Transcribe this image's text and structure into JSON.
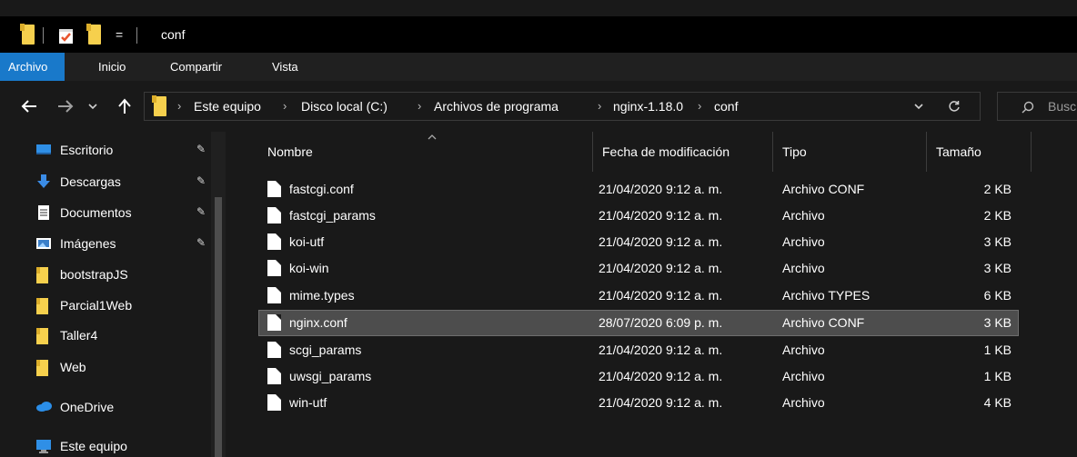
{
  "window": {
    "title": "conf"
  },
  "quick_access_toolbar": {
    "icons": [
      "folder-icon",
      "properties-icon",
      "new-folder-icon",
      "customize-dropdown-icon"
    ],
    "dropdown_glyph": "="
  },
  "ribbon": {
    "tabs": [
      {
        "label": "Archivo",
        "active": true
      },
      {
        "label": "Inicio",
        "active": false
      },
      {
        "label": "Compartir",
        "active": false
      },
      {
        "label": "Vista",
        "active": false
      }
    ],
    "active_color": "#1979ca"
  },
  "navigation": {
    "back_icon": "arrow-left-icon",
    "forward_icon": "arrow-right-icon",
    "recent_icon": "chevron-down-icon",
    "up_icon": "arrow-up-icon",
    "breadcrumbs": [
      "Este equipo",
      "Disco local (C:)",
      "Archivos de programa",
      "nginx-1.18.0",
      "conf"
    ],
    "search_placeholder": "Busc"
  },
  "sidebar": {
    "items": [
      {
        "label": "Escritorio",
        "icon": "desktop-icon",
        "pinned": true
      },
      {
        "label": "Descargas",
        "icon": "download-icon",
        "pinned": true
      },
      {
        "label": "Documentos",
        "icon": "document-icon",
        "pinned": true
      },
      {
        "label": "Imágenes",
        "icon": "picture-icon",
        "pinned": true
      },
      {
        "label": "bootstrapJS",
        "icon": "folder-icon",
        "pinned": false
      },
      {
        "label": "Parcial1Web",
        "icon": "folder-icon",
        "pinned": false
      },
      {
        "label": "Taller4",
        "icon": "folder-icon",
        "pinned": false
      },
      {
        "label": "Web",
        "icon": "folder-icon",
        "pinned": false
      },
      {
        "label": "OneDrive",
        "icon": "cloud-icon",
        "pinned": false
      },
      {
        "label": "Este equipo",
        "icon": "computer-icon",
        "pinned": false
      }
    ]
  },
  "file_list": {
    "columns": {
      "name": "Nombre",
      "modified": "Fecha de modificación",
      "type": "Tipo",
      "size": "Tamaño"
    },
    "rows": [
      {
        "name": "fastcgi.conf",
        "modified": "21/04/2020 9:12 a. m.",
        "type": "Archivo CONF",
        "size": "2 KB",
        "selected": false
      },
      {
        "name": "fastcgi_params",
        "modified": "21/04/2020 9:12 a. m.",
        "type": "Archivo",
        "size": "2 KB",
        "selected": false
      },
      {
        "name": "koi-utf",
        "modified": "21/04/2020 9:12 a. m.",
        "type": "Archivo",
        "size": "3 KB",
        "selected": false
      },
      {
        "name": "koi-win",
        "modified": "21/04/2020 9:12 a. m.",
        "type": "Archivo",
        "size": "3 KB",
        "selected": false
      },
      {
        "name": "mime.types",
        "modified": "21/04/2020 9:12 a. m.",
        "type": "Archivo TYPES",
        "size": "6 KB",
        "selected": false
      },
      {
        "name": "nginx.conf",
        "modified": "28/07/2020 6:09 p. m.",
        "type": "Archivo CONF",
        "size": "3 KB",
        "selected": true
      },
      {
        "name": "scgi_params",
        "modified": "21/04/2020 9:12 a. m.",
        "type": "Archivo",
        "size": "1 KB",
        "selected": false
      },
      {
        "name": "uwsgi_params",
        "modified": "21/04/2020 9:12 a. m.",
        "type": "Archivo",
        "size": "1 KB",
        "selected": false
      },
      {
        "name": "win-utf",
        "modified": "21/04/2020 9:12 a. m.",
        "type": "Archivo",
        "size": "4 KB",
        "selected": false
      }
    ]
  },
  "colors": {
    "background": "#191919",
    "title_bar": "#000000",
    "folder": "#f6d04d",
    "selected_row": "#4d4d4d"
  }
}
